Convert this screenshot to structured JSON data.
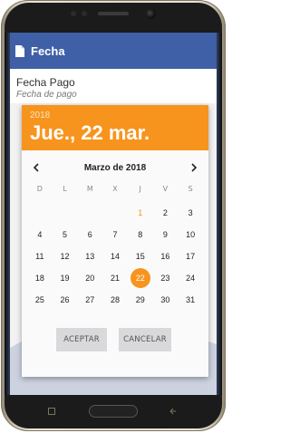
{
  "app_bar": {
    "title": "Fecha",
    "icon": "document-icon",
    "color": "#3f5fa6"
  },
  "field": {
    "label": "Fecha Pago",
    "placeholder": "Fecha de pago"
  },
  "dialog": {
    "year": "2018",
    "date_title": "Jue., 22 mar.",
    "header_color": "#f7941d",
    "month_label": "Marzo de 2018",
    "weekdays": [
      "D",
      "L",
      "M",
      "X",
      "J",
      "V",
      "S"
    ],
    "leading_blanks": 4,
    "days": [
      "1",
      "2",
      "3",
      "4",
      "5",
      "6",
      "7",
      "8",
      "9",
      "10",
      "11",
      "12",
      "13",
      "14",
      "15",
      "16",
      "17",
      "18",
      "19",
      "20",
      "21",
      "22",
      "23",
      "24",
      "25",
      "26",
      "27",
      "28",
      "29",
      "30",
      "31"
    ],
    "today_day": "1",
    "selected_day": "22",
    "accept_label": "ACEPTAR",
    "cancel_label": "CANCELAR"
  }
}
